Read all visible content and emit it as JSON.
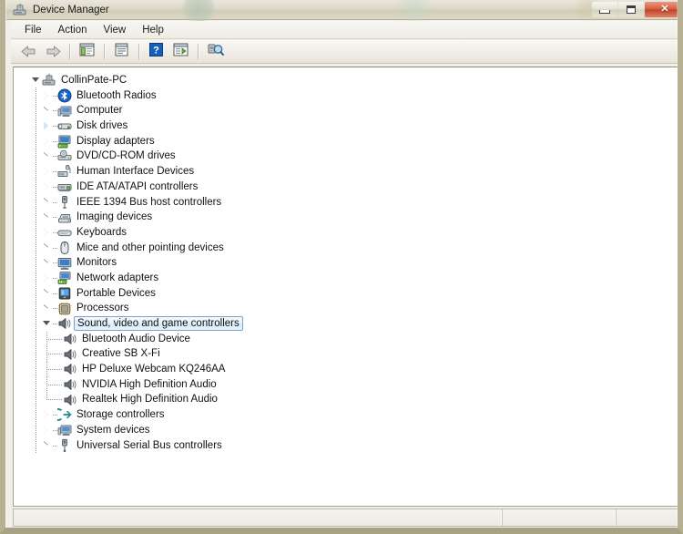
{
  "window": {
    "title": "Device Manager",
    "icon": "device-manager-icon",
    "buttons": {
      "minimize": "Minimize",
      "maximize": "Maximize",
      "close": "✕"
    }
  },
  "menubar": {
    "items": [
      {
        "label": "File",
        "name": "menu-file"
      },
      {
        "label": "Action",
        "name": "menu-action"
      },
      {
        "label": "View",
        "name": "menu-view"
      },
      {
        "label": "Help",
        "name": "menu-help"
      }
    ]
  },
  "toolbar": {
    "items": [
      {
        "name": "back-button",
        "icon": "back-arrow-icon",
        "label": "Back"
      },
      {
        "name": "forward-button",
        "icon": "forward-arrow-icon",
        "label": "Forward"
      },
      {
        "name": "show-hide-console-tree-button",
        "icon": "console-tree-icon",
        "label": "Show/Hide Console Tree"
      },
      {
        "name": "properties-button",
        "icon": "properties-icon",
        "label": "Properties"
      },
      {
        "name": "help-button",
        "icon": "help-question-icon",
        "label": "Help"
      },
      {
        "name": "update-driver-button",
        "icon": "update-driver-icon",
        "label": "Update Driver Software"
      },
      {
        "name": "scan-hardware-changes-button",
        "icon": "scan-hardware-icon",
        "label": "Scan for hardware changes"
      }
    ]
  },
  "tree": {
    "root": {
      "label": "CollinPate-PC",
      "icon": "computer-tower-icon",
      "expanded": true
    },
    "nodes": [
      {
        "label": "Bluetooth Radios",
        "icon": "bluetooth-icon",
        "state": "collapsed"
      },
      {
        "label": "Computer",
        "icon": "computer-icon",
        "state": "collapsed"
      },
      {
        "label": "Disk drives",
        "icon": "disk-drive-icon",
        "state": "collapsed-hot"
      },
      {
        "label": "Display adapters",
        "icon": "display-adapter-icon",
        "state": "collapsed"
      },
      {
        "label": "DVD/CD-ROM drives",
        "icon": "dvd-drive-icon",
        "state": "collapsed"
      },
      {
        "label": "Human Interface Devices",
        "icon": "hid-icon",
        "state": "collapsed"
      },
      {
        "label": "IDE ATA/ATAPI controllers",
        "icon": "ide-controller-icon",
        "state": "collapsed"
      },
      {
        "label": "IEEE 1394 Bus host controllers",
        "icon": "ieee1394-icon",
        "state": "collapsed"
      },
      {
        "label": "Imaging devices",
        "icon": "imaging-device-icon",
        "state": "collapsed"
      },
      {
        "label": "Keyboards",
        "icon": "keyboard-icon",
        "state": "collapsed"
      },
      {
        "label": "Mice and other pointing devices",
        "icon": "mouse-icon",
        "state": "collapsed"
      },
      {
        "label": "Monitors",
        "icon": "monitor-icon",
        "state": "collapsed"
      },
      {
        "label": "Network adapters",
        "icon": "network-adapter-icon",
        "state": "collapsed"
      },
      {
        "label": "Portable Devices",
        "icon": "portable-device-icon",
        "state": "collapsed"
      },
      {
        "label": "Processors",
        "icon": "processor-icon",
        "state": "collapsed"
      },
      {
        "label": "Sound, video and game controllers",
        "icon": "speaker-icon",
        "state": "expanded",
        "selected": true
      },
      {
        "label": "Storage controllers",
        "icon": "storage-controller-icon",
        "state": "collapsed"
      },
      {
        "label": "System devices",
        "icon": "system-device-icon",
        "state": "collapsed"
      },
      {
        "label": "Universal Serial Bus controllers",
        "icon": "usb-controller-icon",
        "state": "collapsed"
      }
    ],
    "children": [
      {
        "label": "Bluetooth Audio Device",
        "icon": "speaker-icon"
      },
      {
        "label": "Creative SB X-Fi",
        "icon": "speaker-icon"
      },
      {
        "label": "HP Deluxe Webcam KQ246AA",
        "icon": "speaker-icon"
      },
      {
        "label": "NVIDIA High Definition Audio",
        "icon": "speaker-icon"
      },
      {
        "label": "Realtek High Definition Audio",
        "icon": "speaker-icon"
      }
    ]
  },
  "statusbar": {
    "panels": [
      "",
      "",
      ""
    ]
  },
  "colors": {
    "selection_border": "#7da2ce",
    "selection_fill": "#e6f2fb",
    "close_button": "#c0442a",
    "window_frame": "#b8b093",
    "bluetooth_blue": "#1a66c7"
  }
}
